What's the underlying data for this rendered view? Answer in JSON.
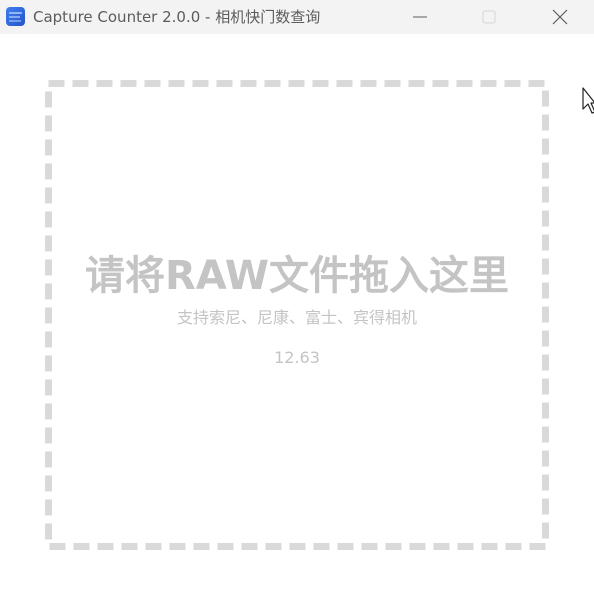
{
  "window": {
    "title": "Capture Counter 2.0.0 - 相机快门数查询"
  },
  "drop_zone": {
    "main_text": "请将RAW文件拖入这里",
    "sub_text": "支持索尼、尼康、富士、宾得相机",
    "version": "12.63"
  },
  "icons": {
    "app": "app-icon",
    "minimize": "minimize-icon",
    "maximize": "maximize-icon",
    "close": "close-icon",
    "cursor": "mouse-cursor-icon"
  },
  "colors": {
    "titlebar": "#f3f3f3",
    "title_text": "#5c5c5c",
    "drop_border": "#d9d9d9",
    "drop_text": "#c4c4c4"
  }
}
